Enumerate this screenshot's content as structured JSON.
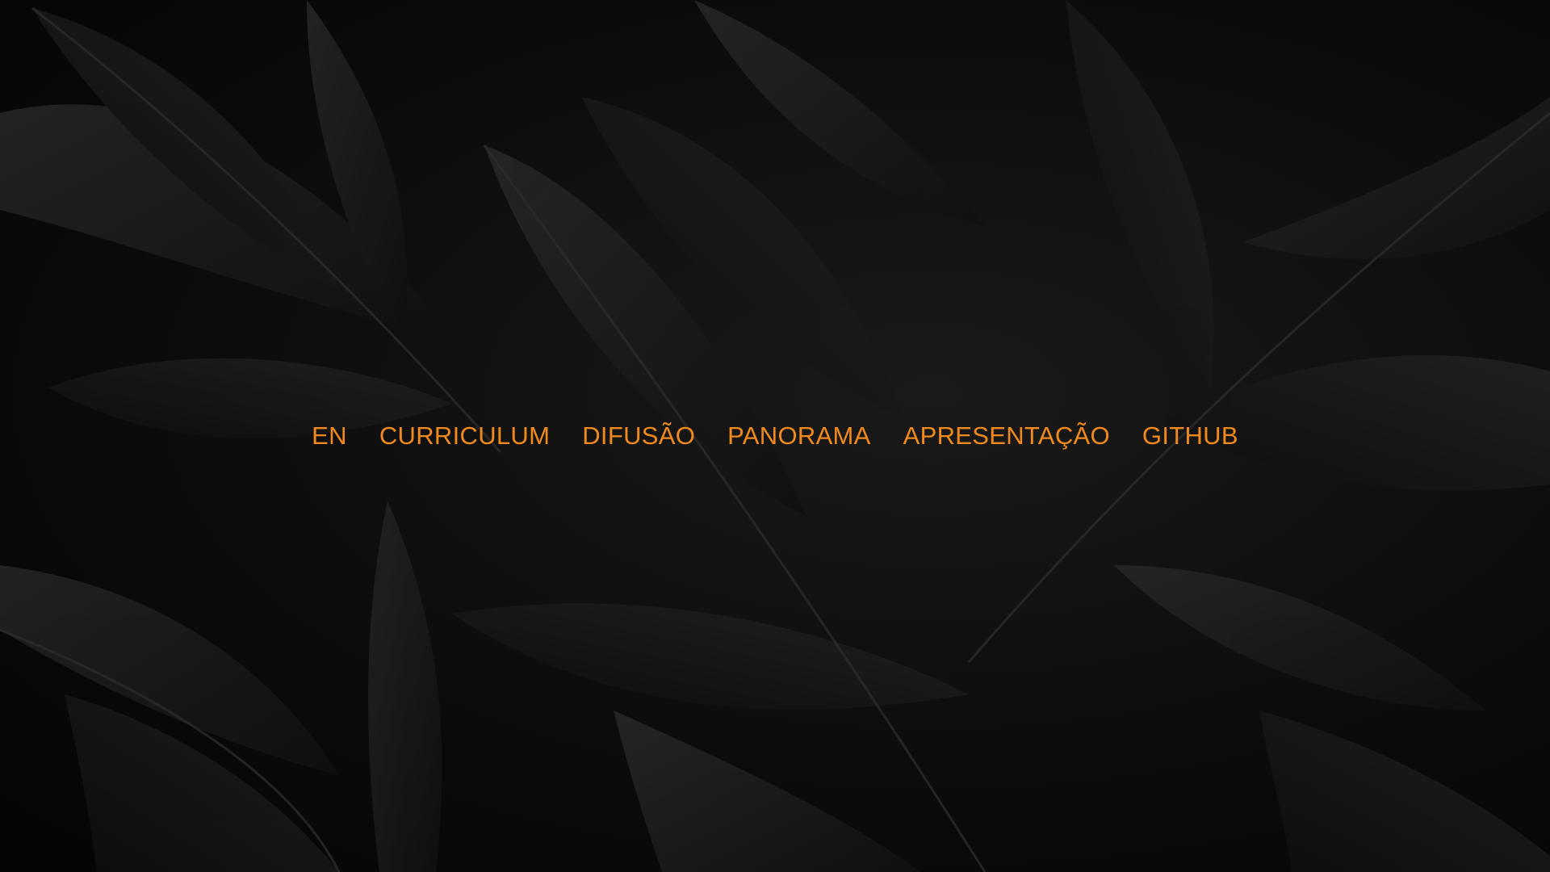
{
  "theme": {
    "accent": "#f08a1c",
    "background": "#0a0a0a",
    "leaf_color": "#1c1c1c"
  },
  "background": {
    "icon": "dark-leaves-pattern"
  },
  "nav": {
    "items": [
      {
        "label": "EN"
      },
      {
        "label": "CURRICULUM"
      },
      {
        "label": "DIFUSÃO"
      },
      {
        "label": "PANORAMA"
      },
      {
        "label": "APRESENTAÇÃO"
      },
      {
        "label": "GITHUB"
      }
    ]
  }
}
